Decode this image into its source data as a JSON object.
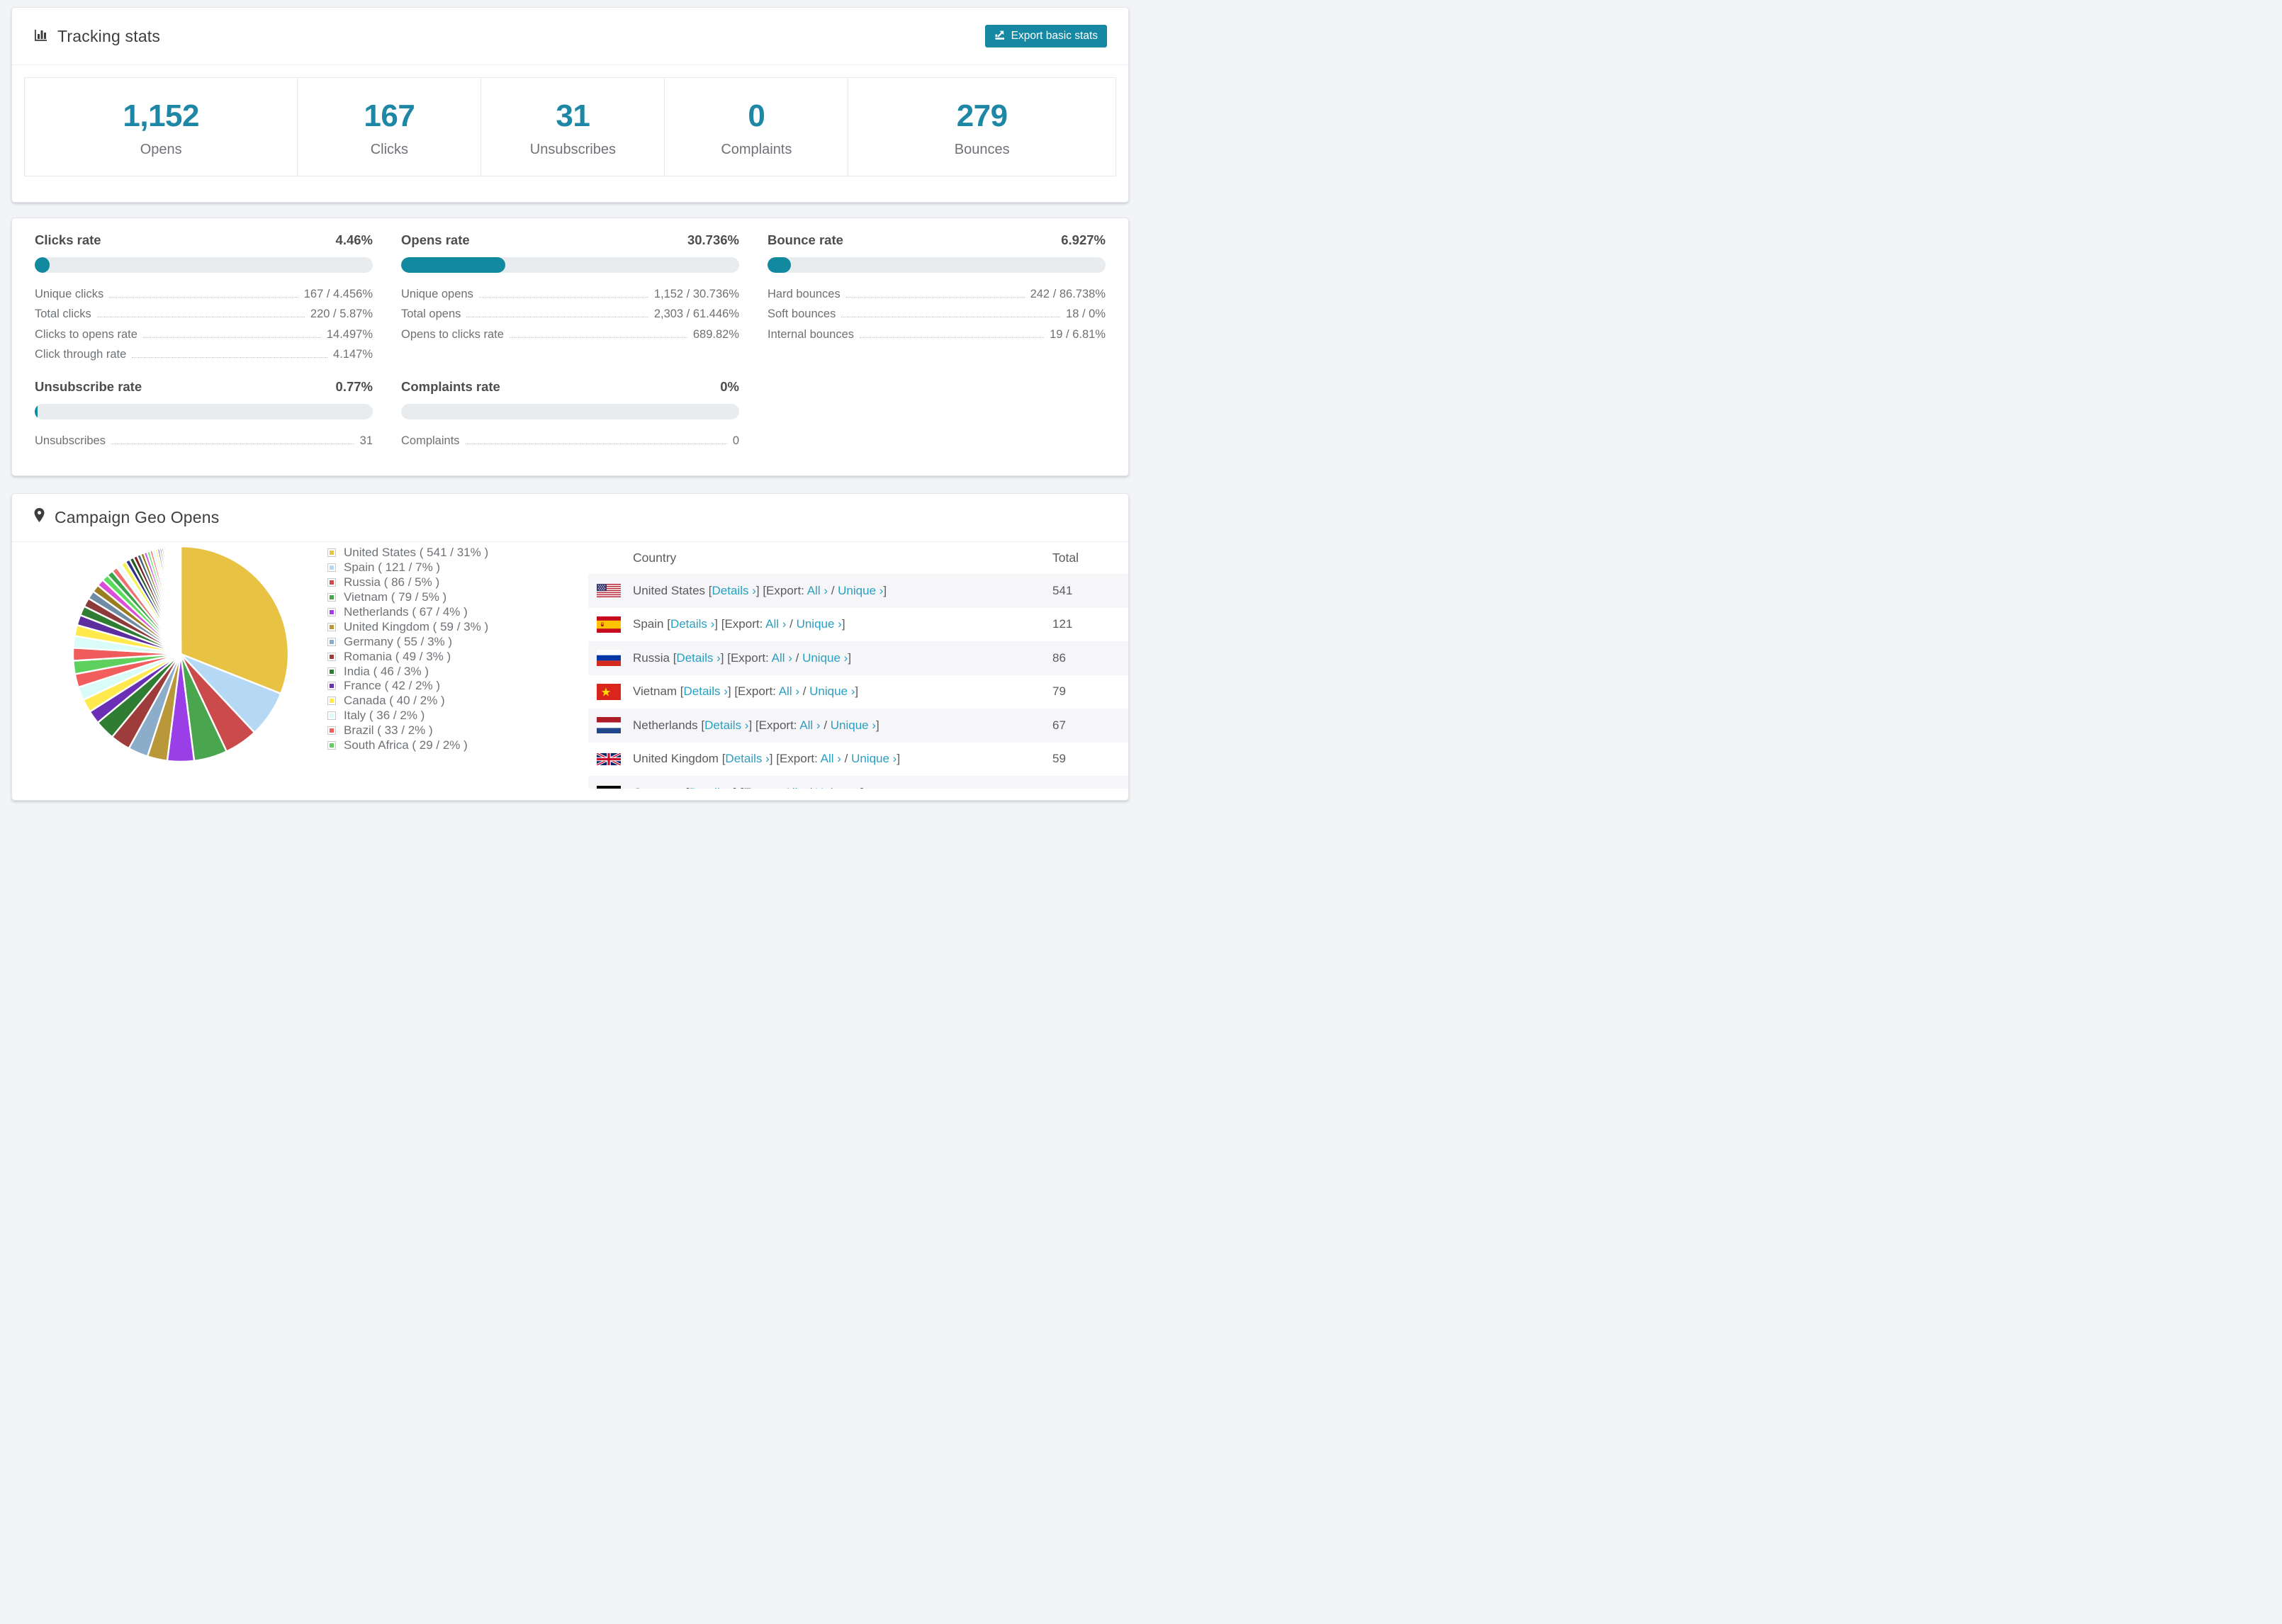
{
  "colors": {
    "accent": "#1d87a5",
    "link": "#2a9fc2",
    "bar_fill": "#11899e",
    "bar_track": "#e9ecef",
    "button_bg": "#1688a4"
  },
  "tracking": {
    "title": "Tracking stats",
    "export_button": "Export basic stats",
    "summary": [
      {
        "value": "1,152",
        "label": "Opens"
      },
      {
        "value": "167",
        "label": "Clicks"
      },
      {
        "value": "31",
        "label": "Unsubscribes"
      },
      {
        "value": "0",
        "label": "Complaints"
      },
      {
        "value": "279",
        "label": "Bounces"
      }
    ]
  },
  "rates": {
    "clicks": {
      "title": "Clicks rate",
      "value": "4.46%",
      "percent": 4.46,
      "rows": [
        {
          "label": "Unique clicks",
          "value": "167 / 4.456%"
        },
        {
          "label": "Total clicks",
          "value": "220 / 5.87%"
        },
        {
          "label": "Clicks to opens rate",
          "value": "14.497%"
        },
        {
          "label": "Click through rate",
          "value": "4.147%"
        }
      ]
    },
    "opens": {
      "title": "Opens rate",
      "value": "30.736%",
      "percent": 30.736,
      "rows": [
        {
          "label": "Unique opens",
          "value": "1,152 / 30.736%"
        },
        {
          "label": "Total opens",
          "value": "2,303 / 61.446%"
        },
        {
          "label": "Opens to clicks rate",
          "value": "689.82%"
        }
      ]
    },
    "bounce": {
      "title": "Bounce rate",
      "value": "6.927%",
      "percent": 6.927,
      "rows": [
        {
          "label": "Hard bounces",
          "value": "242 / 86.738%"
        },
        {
          "label": "Soft bounces",
          "value": "18 / 0%"
        },
        {
          "label": "Internal bounces",
          "value": "19 / 6.81%"
        }
      ]
    },
    "unsubscribe": {
      "title": "Unsubscribe rate",
      "value": "0.77%",
      "percent": 0.77,
      "rows": [
        {
          "label": "Unsubscribes",
          "value": "31"
        }
      ]
    },
    "complaints": {
      "title": "Complaints rate",
      "value": "0%",
      "percent": 0,
      "rows": [
        {
          "label": "Complaints",
          "value": "0"
        }
      ]
    }
  },
  "geo": {
    "title": "Campaign Geo Opens",
    "table": {
      "headers": [
        "Country",
        "Total"
      ],
      "links": {
        "details": "Details ›",
        "export_prefix": "[Export:",
        "all": "All ›",
        "sep": "/",
        "unique": "Unique ›"
      },
      "rows": [
        {
          "country": "United States",
          "flag": "us",
          "total": "541"
        },
        {
          "country": "Spain",
          "flag": "es",
          "total": "121"
        },
        {
          "country": "Russia",
          "flag": "ru",
          "total": "86"
        },
        {
          "country": "Vietnam",
          "flag": "vn",
          "total": "79"
        },
        {
          "country": "Netherlands",
          "flag": "nl",
          "total": "67"
        },
        {
          "country": "United Kingdom",
          "flag": "gb",
          "total": "59"
        },
        {
          "country": "Germany",
          "flag": "de",
          "total": ""
        }
      ]
    }
  },
  "chart_data": {
    "type": "pie",
    "title": "Campaign Geo Opens",
    "legend_position": "right",
    "start_angle_deg": -90,
    "direction": "clockwise",
    "series": [
      {
        "name": "United States",
        "value": 541,
        "pct": 31,
        "color": "#e7c243",
        "legend": "United States ( 541 / 31% )"
      },
      {
        "name": "Spain",
        "value": 121,
        "pct": 7,
        "color": "#b5d9f5",
        "legend": "Spain ( 121 / 7% )"
      },
      {
        "name": "Russia",
        "value": 86,
        "pct": 5,
        "color": "#cb4a4c",
        "legend": "Russia ( 86 / 5% )"
      },
      {
        "name": "Vietnam",
        "value": 79,
        "pct": 5,
        "color": "#4aa64e",
        "legend": "Vietnam ( 79 / 5% )"
      },
      {
        "name": "Netherlands",
        "value": 67,
        "pct": 4,
        "color": "#9a3fe8",
        "legend": "Netherlands ( 67 / 4% )"
      },
      {
        "name": "United Kingdom",
        "value": 59,
        "pct": 3,
        "color": "#b9983a",
        "legend": "United Kingdom ( 59 / 3% )"
      },
      {
        "name": "Germany",
        "value": 55,
        "pct": 3,
        "color": "#8badc9",
        "legend": "Germany ( 55 / 3% )"
      },
      {
        "name": "Romania",
        "value": 49,
        "pct": 3,
        "color": "#9e3b3b",
        "legend": "Romania ( 49 / 3% )"
      },
      {
        "name": "India",
        "value": 46,
        "pct": 3,
        "color": "#2e7d32",
        "legend": "India ( 46 / 3% )"
      },
      {
        "name": "France",
        "value": 42,
        "pct": 2,
        "color": "#6a2fb5",
        "legend": "France ( 42 / 2% )"
      },
      {
        "name": "Canada",
        "value": 40,
        "pct": 2,
        "color": "#ffe94d",
        "legend": "Canada ( 40 / 2% )"
      },
      {
        "name": "Italy",
        "value": 36,
        "pct": 2,
        "color": "#d9fcf8",
        "legend": "Italy ( 36 / 2% )"
      },
      {
        "name": "Brazil",
        "value": 33,
        "pct": 2,
        "color": "#f25e5e",
        "legend": "Brazil ( 33 / 2% )"
      },
      {
        "name": "South Africa",
        "value": 29,
        "pct": 2,
        "color": "#5dd05d",
        "legend": "South Africa ( 29 / 2% )"
      }
    ],
    "others_slices": {
      "total_pct": 26,
      "count": 42,
      "start_pct": 1.65,
      "decay": 0.93,
      "colors": [
        "#f05c5c",
        "#d9fcf8",
        "#ffe94d",
        "#5b2d9e",
        "#2e7d32",
        "#8c3a3a",
        "#6e8ca3",
        "#9a7d1e",
        "#d94fd9",
        "#5bdb5b",
        "#3aa64a",
        "#ef7070",
        "#eefcff",
        "#f3f34f",
        "#30308a",
        "#1f5c21",
        "#7c2020",
        "#44607a",
        "#8f7a10",
        "#cc55ee",
        "#71e871",
        "#ff6b6b",
        "#d6f5ff",
        "#fff35c",
        "#5533aa",
        "#2a6b2e",
        "#a03c3c",
        "#5d7f94",
        "#b59a26",
        "#e05ce0",
        "#62d962",
        "#ff5252",
        "#e4fffb",
        "#ffff66",
        "#442299",
        "#175c17",
        "#883333",
        "#33ccff",
        "#bb66ff",
        "#88ee44",
        "#ff4477",
        "#66ffee"
      ]
    }
  }
}
